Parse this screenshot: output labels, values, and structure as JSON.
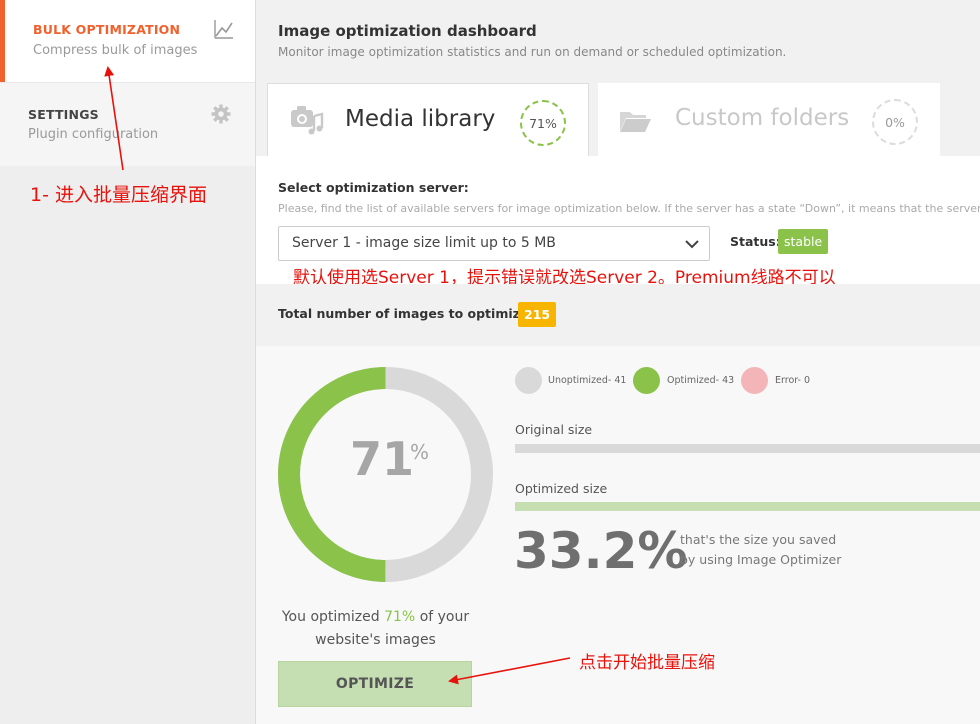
{
  "sidebar": {
    "items": [
      {
        "title": "BULK OPTIMIZATION",
        "subtitle": "Compress bulk of images",
        "icon": "chart-line-icon",
        "active": true
      },
      {
        "title": "SETTINGS",
        "subtitle": "Plugin configuration",
        "icon": "gear-icon",
        "active": false
      }
    ]
  },
  "header": {
    "title": "Image optimization dashboard",
    "subtitle": "Monitor image optimization statistics and run on demand or scheduled optimization."
  },
  "tabs": [
    {
      "label": "Media library",
      "percent": "71%",
      "icon": "camera-music-icon",
      "active": true
    },
    {
      "label": "Custom folders",
      "percent": "0%",
      "icon": "folder-icon",
      "active": false
    }
  ],
  "server": {
    "label": "Select optimization server:",
    "help": "Please, find the list of available servers for image optimization below. If the server has a state “Down”, it means that the server is not available.",
    "selected": "Server 1 - image size limit up to 5 MB",
    "status_label": "Status:",
    "status_value": "stable"
  },
  "total": {
    "label": "Total number of images to optimize",
    "count": "215"
  },
  "stats": {
    "percent_number": "71",
    "percent_sign": "%",
    "percent_value": 71,
    "legend": [
      {
        "label": "Unoptimized- 41",
        "color": "#d9d9d9"
      },
      {
        "label": "Optimized- 43",
        "color": "#8bc34a"
      },
      {
        "label": "Error- 0",
        "color": "#f4b5b8"
      }
    ],
    "original_label": "Original size",
    "optimized_label": "Optimized size",
    "saved_percent": "33.2%",
    "saved_text_1": "that's the size you saved",
    "saved_text_2": "by using Image Optimizer",
    "you_optimized_pre": "You optimized",
    "you_optimized_pct": "71%",
    "you_optimized_post": "of your",
    "you_optimized_line2": "website's images",
    "optimize_button": "OPTIMIZE"
  },
  "annotations": {
    "step1": "1- 进入批量压缩界面",
    "server_note": "默认使用选Server 1，提示错误就改选Server 2。Premium线路不可以",
    "click_note": "点击开始批量压缩"
  },
  "colors": {
    "accent_orange": "#f0612d",
    "green": "#8bc34a",
    "badge_yellow": "#f7b500",
    "annotation_red": "#e8120c"
  }
}
